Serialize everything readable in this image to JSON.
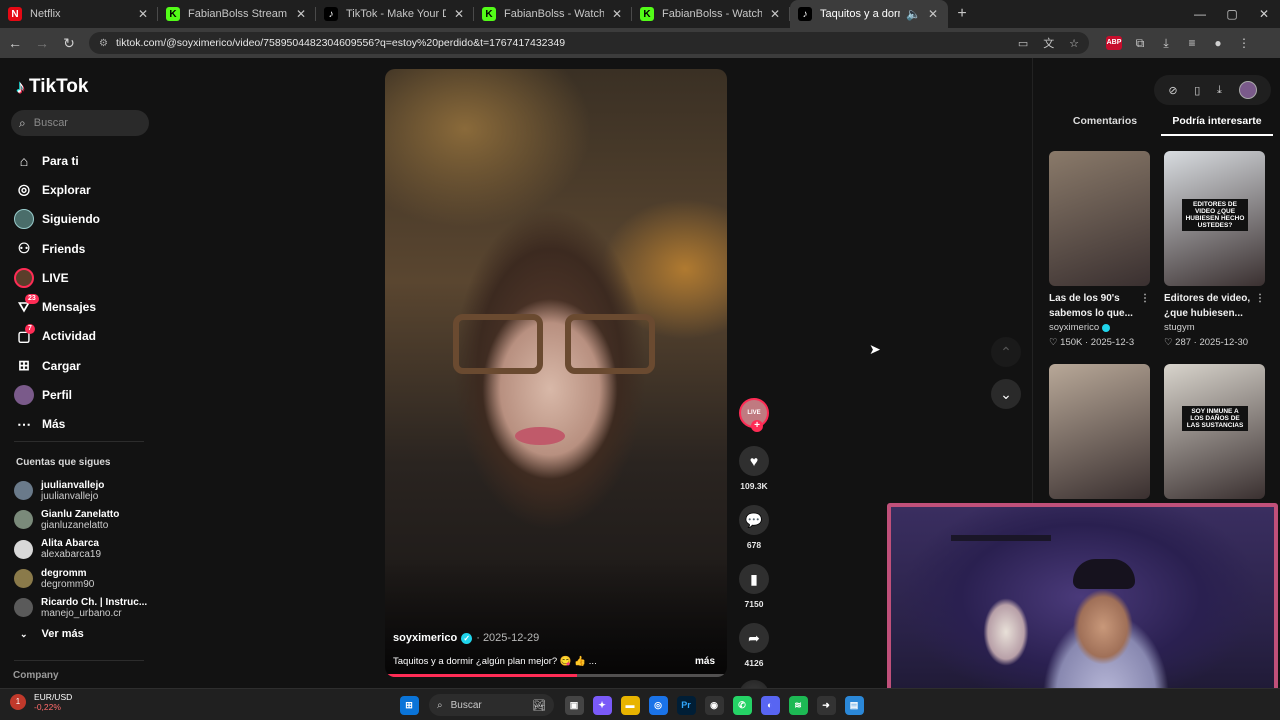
{
  "browser": {
    "tabs": [
      {
        "label": "Netflix",
        "favicon": "netflix-icon",
        "color": "#e50914",
        "glyph": "N"
      },
      {
        "label": "FabianBolss Stream - Watch Live",
        "favicon": "kick-icon",
        "color": "#53fc18",
        "glyph": "K"
      },
      {
        "label": "TikTok - Make Your Day",
        "favicon": "tiktok-icon",
        "color": "#000000",
        "glyph": "♪"
      },
      {
        "label": "FabianBolss - Watch clips on Kick",
        "favicon": "kick-icon",
        "color": "#53fc18",
        "glyph": "K"
      },
      {
        "label": "FabianBolss - Watch clips on Kick",
        "favicon": "kick-icon",
        "color": "#53fc18",
        "glyph": "K"
      },
      {
        "label": "Taquitos y a dormir: el mejor",
        "favicon": "tiktok-icon",
        "color": "#000000",
        "glyph": "♪",
        "active": true
      }
    ],
    "url": "tiktok.com/@soyximerico/video/7589504482304609556?q=estoy%20perdido&t=1767417432349"
  },
  "sidebar": {
    "logo": "TikTok",
    "search_placeholder": "Buscar",
    "nav": [
      {
        "label": "Para ti",
        "icon": "home-icon"
      },
      {
        "label": "Explorar",
        "icon": "compass-icon"
      },
      {
        "label": "Siguiendo",
        "icon": "following-avatar-icon"
      },
      {
        "label": "Friends",
        "icon": "friends-icon"
      },
      {
        "label": "LIVE",
        "icon": "live-icon"
      },
      {
        "label": "Mensajes",
        "icon": "messages-icon",
        "badge": "23"
      },
      {
        "label": "Actividad",
        "icon": "activity-icon",
        "badge": "7"
      },
      {
        "label": "Cargar",
        "icon": "upload-icon"
      },
      {
        "label": "Perfil",
        "icon": "profile-icon"
      },
      {
        "label": "Más",
        "icon": "more-icon"
      }
    ],
    "following_title": "Cuentas que sigues",
    "following": [
      {
        "name": "juulianvallejo",
        "handle": "juulianvallejo",
        "color": "#6a7a8a"
      },
      {
        "name": "Gianlu Zanelatto",
        "handle": "gianluzanelatto",
        "color": "#7a8a7a"
      },
      {
        "name": "Alita Abarca",
        "handle": "alexabarca19",
        "color": "#d8d8d8"
      },
      {
        "name": "degromm",
        "handle": "degromm90",
        "color": "#8a7a4a"
      },
      {
        "name": "Ricardo Ch. | Instruc...",
        "handle": "manejo_urbano.cr",
        "color": "#5a5a5a"
      }
    ],
    "see_more": "Ver más",
    "company": "Company"
  },
  "video": {
    "author": "soyximerico",
    "date": "2025-12-29",
    "caption": "Taquitos y a dormir ¿algún plan mejor? 😋 👍 ...",
    "more": "más",
    "progress": 0.56,
    "live_label": "LIVE",
    "likes": "109.3K",
    "comments": "678",
    "saves": "7150",
    "shares": "4126"
  },
  "right_panel": {
    "tabs": [
      "Comentarios",
      "Podría interesarte"
    ],
    "active_tab": "Podría interesarte",
    "cards": [
      {
        "title": "Las de los 90's sabemos lo que...",
        "author": "soyximerico",
        "verified": true,
        "likes": "150K",
        "date": "2025-12-3",
        "thumb": "#8a7a6a"
      },
      {
        "title": "Editores de video, ¿que hubiesen...",
        "author": "stugym",
        "verified": false,
        "likes": "287",
        "date": "2025-12-30",
        "thumb": "#d8dce0",
        "overlay": "EDITORES DE VIDEO ¿QUE HUBIESEN HECHO USTEDES?"
      },
      {
        "title": "",
        "author": "",
        "likes": "",
        "date": "",
        "thumb": "#b8a898"
      },
      {
        "title": "",
        "author": "",
        "likes": "",
        "date": "",
        "thumb": "#d8d4cc",
        "overlay": "SOY INMUNE A LOS DAÑOS DE LAS SUSTANCIAS"
      }
    ]
  },
  "taskbar": {
    "ticker": "EUR/USD",
    "change": "-0,22%",
    "alert": "1",
    "search": "Buscar"
  }
}
